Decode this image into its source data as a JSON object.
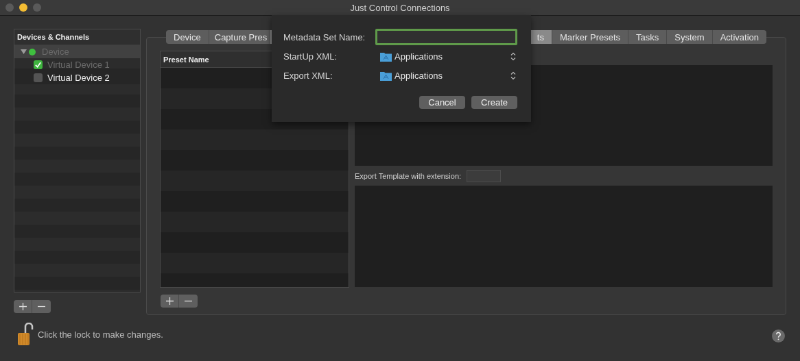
{
  "window": {
    "title": "Just Control Connections"
  },
  "sidebar": {
    "header": "Devices & Channels",
    "tree": [
      {
        "label": "Device",
        "expanded": true,
        "disabled": true,
        "color": "#3fbf3f",
        "children": [
          {
            "label": "Virtual Device 1",
            "checked": true,
            "disabled": true
          },
          {
            "label": "Virtual Device 2",
            "checked": false,
            "disabled": false
          }
        ]
      }
    ]
  },
  "tabs": [
    {
      "label": "Device",
      "selected": false
    },
    {
      "label": "Capture Pres",
      "selected": false
    },
    {
      "label": "ts",
      "selected": true
    },
    {
      "label": "Marker Presets",
      "selected": false
    },
    {
      "label": "Tasks",
      "selected": false
    },
    {
      "label": "System",
      "selected": false
    },
    {
      "label": "Activation",
      "selected": false
    }
  ],
  "table": {
    "columns": [
      "Preset Name"
    ]
  },
  "export_template": {
    "label": "Export Template with extension:"
  },
  "dialog": {
    "name_field": {
      "label": "Metadata Set Name:",
      "focused": true
    },
    "popups": [
      {
        "label": "StartUp XML:",
        "value": "Applications"
      },
      {
        "label": "Export XML:",
        "value": "Applications"
      }
    ],
    "buttons": [
      "Cancel",
      "Create"
    ]
  },
  "lock": {
    "locked": false,
    "text": "Click the lock to make changes."
  }
}
